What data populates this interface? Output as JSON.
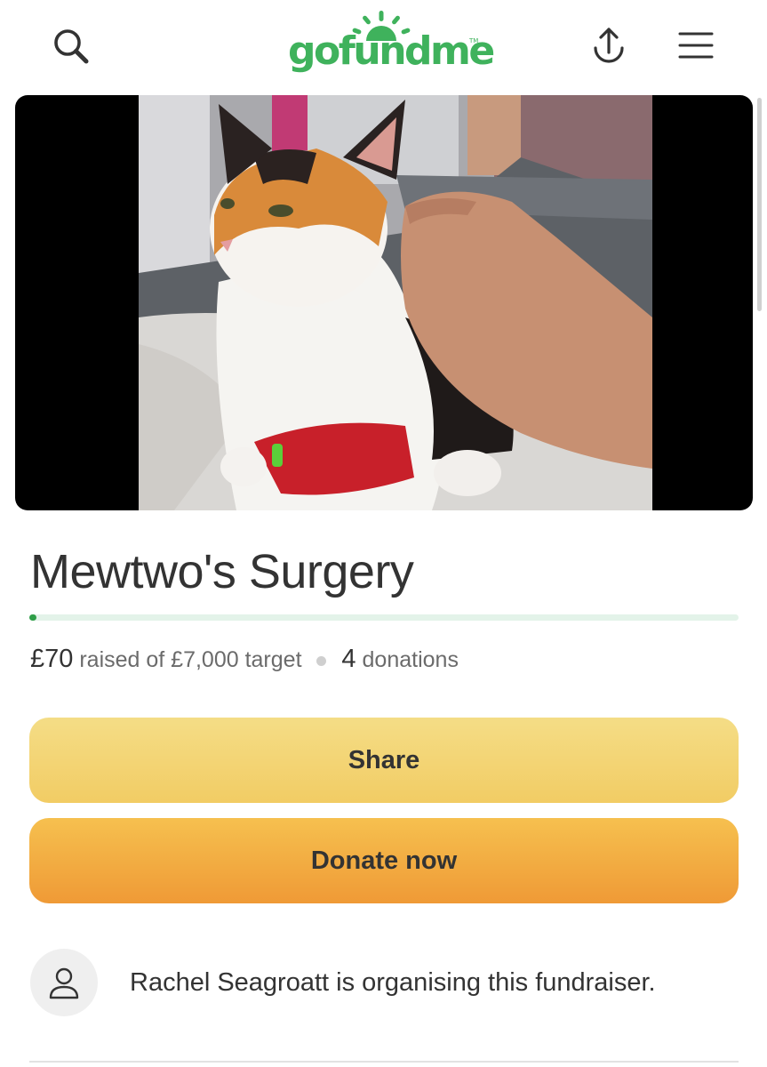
{
  "header": {
    "logo_text": "gofundme",
    "logo_tm": "TM",
    "icons": [
      "search-icon",
      "share-upload-icon",
      "hamburger-menu-icon"
    ]
  },
  "fundraiser": {
    "title": "Mewtwo's Surgery",
    "raised_amount": "£70",
    "raised_of_text": "raised of £7,000 target",
    "donation_count": "4",
    "donations_label": "donations",
    "progress_fraction": 0.01
  },
  "actions": {
    "share_label": "Share",
    "donate_label": "Donate now"
  },
  "organiser": {
    "text": "Rachel Seagroatt is organising this fundraiser."
  },
  "colors": {
    "brand_green": "#3fb25c",
    "progress_fill": "#2f9e48",
    "progress_track": "#e3f3e9",
    "share_button": "#f2d272",
    "donate_button": "#f2aa40",
    "text": "#333333"
  }
}
